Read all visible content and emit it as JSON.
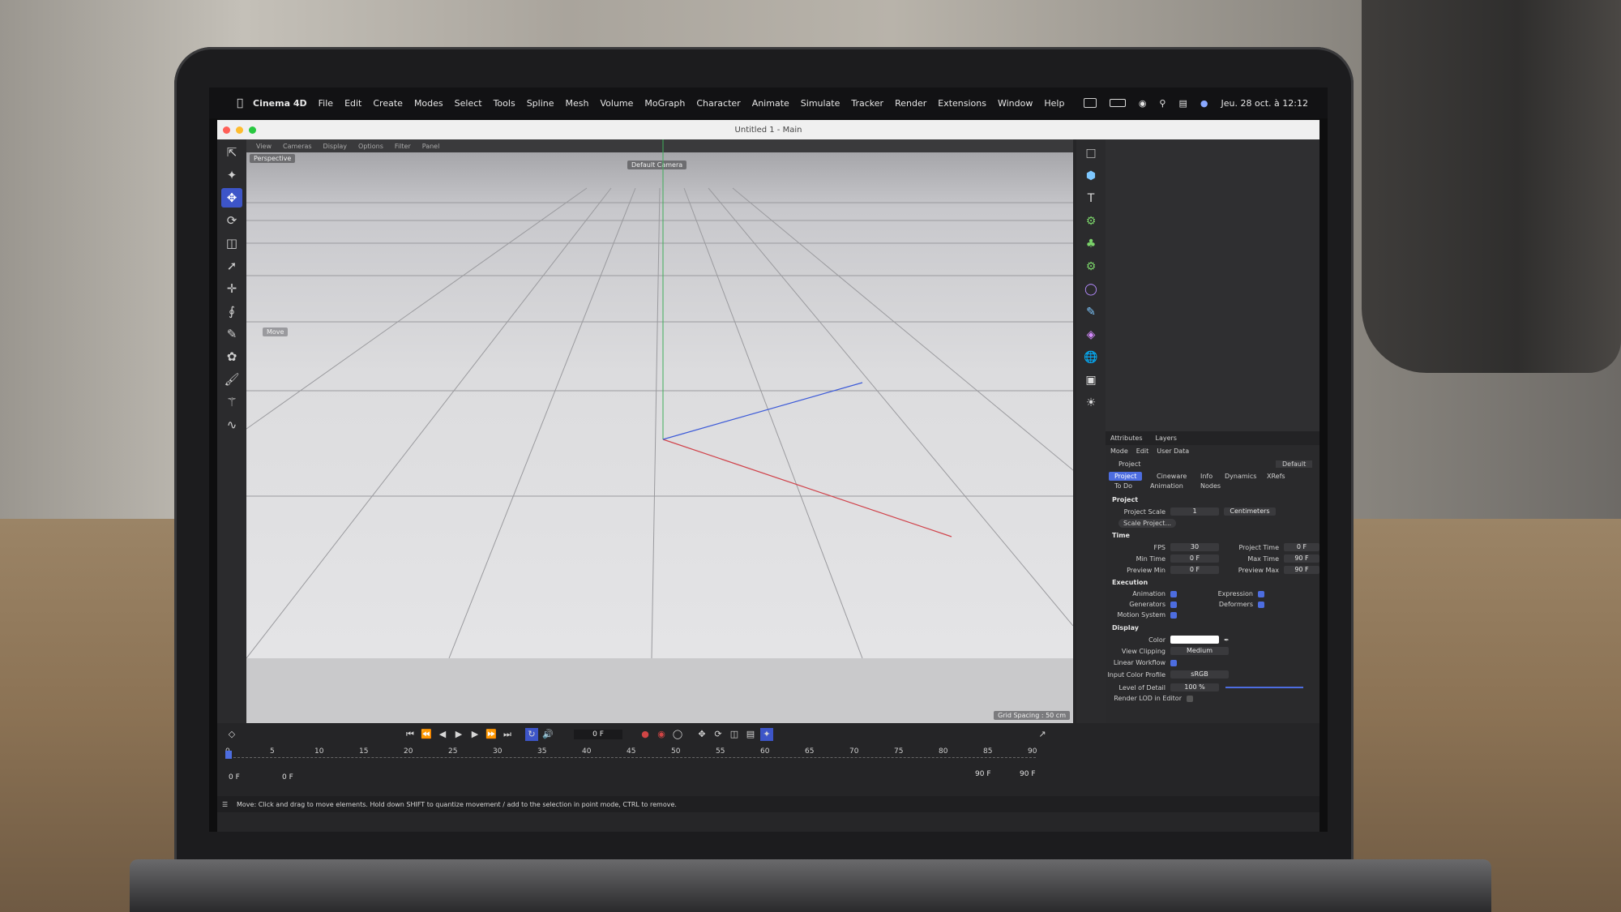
{
  "menubar": {
    "app_name": "Cinema 4D",
    "items": [
      "File",
      "Edit",
      "Create",
      "Modes",
      "Select",
      "Tools",
      "Spline",
      "Mesh",
      "Volume",
      "MoGraph",
      "Character",
      "Animate",
      "Simulate",
      "Tracker",
      "Render",
      "Extensions",
      "Window",
      "Help"
    ],
    "clock": "Jeu. 28 oct. à 12:12"
  },
  "window": {
    "title": "Untitled 1 - Main"
  },
  "viewport": {
    "menu": [
      "View",
      "Cameras",
      "Display",
      "Options",
      "Filter",
      "Panel"
    ],
    "view_name": "Perspective",
    "camera": "Default Camera",
    "tool_hint": "Move",
    "grid_spacing": "Grid Spacing : 50 cm"
  },
  "attributes": {
    "tabs": [
      "Attributes",
      "Layers"
    ],
    "menu": [
      "Mode",
      "Edit",
      "User Data"
    ],
    "object": "Project",
    "preset": "Default",
    "subtabs_row1": [
      "Project",
      "Cineware",
      "Info",
      "Dynamics",
      "XRefs"
    ],
    "subtabs_row2": [
      "To Do",
      "Animation",
      "Nodes"
    ],
    "section_project": "Project",
    "project_scale_label": "Project Scale",
    "project_scale_value": "1",
    "project_scale_unit": "Centimeters",
    "scale_button": "Scale Project...",
    "section_time": "Time",
    "fps_label": "FPS",
    "fps_value": "30",
    "project_time_label": "Project Time",
    "project_time_value": "0 F",
    "min_time_label": "Min Time",
    "min_time_value": "0 F",
    "max_time_label": "Max Time",
    "max_time_value": "90 F",
    "preview_min_label": "Preview Min",
    "preview_min_value": "0 F",
    "preview_max_label": "Preview Max",
    "preview_max_value": "90 F",
    "section_execution": "Execution",
    "animation_label": "Animation",
    "expression_label": "Expression",
    "generators_label": "Generators",
    "deformers_label": "Deformers",
    "motion_system_label": "Motion System",
    "section_display": "Display",
    "color_label": "Color",
    "view_clipping_label": "View Clipping",
    "view_clipping_value": "Medium",
    "linear_workflow_label": "Linear Workflow",
    "input_color_profile_label": "Input Color Profile",
    "input_color_profile_value": "sRGB",
    "lod_label": "Level of Detail",
    "lod_value": "100 %",
    "render_lod_label": "Render LOD in Editor"
  },
  "timeline": {
    "current_frame": "0 F",
    "start_field": "0 F",
    "start_field2": "0 F",
    "end_field": "90 F",
    "end_field2": "90 F",
    "ticks": [
      "0",
      "5",
      "10",
      "15",
      "20",
      "25",
      "30",
      "35",
      "40",
      "45",
      "50",
      "55",
      "60",
      "65",
      "70",
      "75",
      "80",
      "85",
      "90"
    ]
  },
  "status": {
    "text": "Move: Click and drag to move elements. Hold down SHIFT to quantize movement / add to the selection in point mode, CTRL to remove."
  },
  "colors": {
    "accent": "#3d55c8",
    "axis_x": "#d0434b",
    "axis_y": "#3fae5a",
    "axis_z": "#3c5ad8"
  }
}
